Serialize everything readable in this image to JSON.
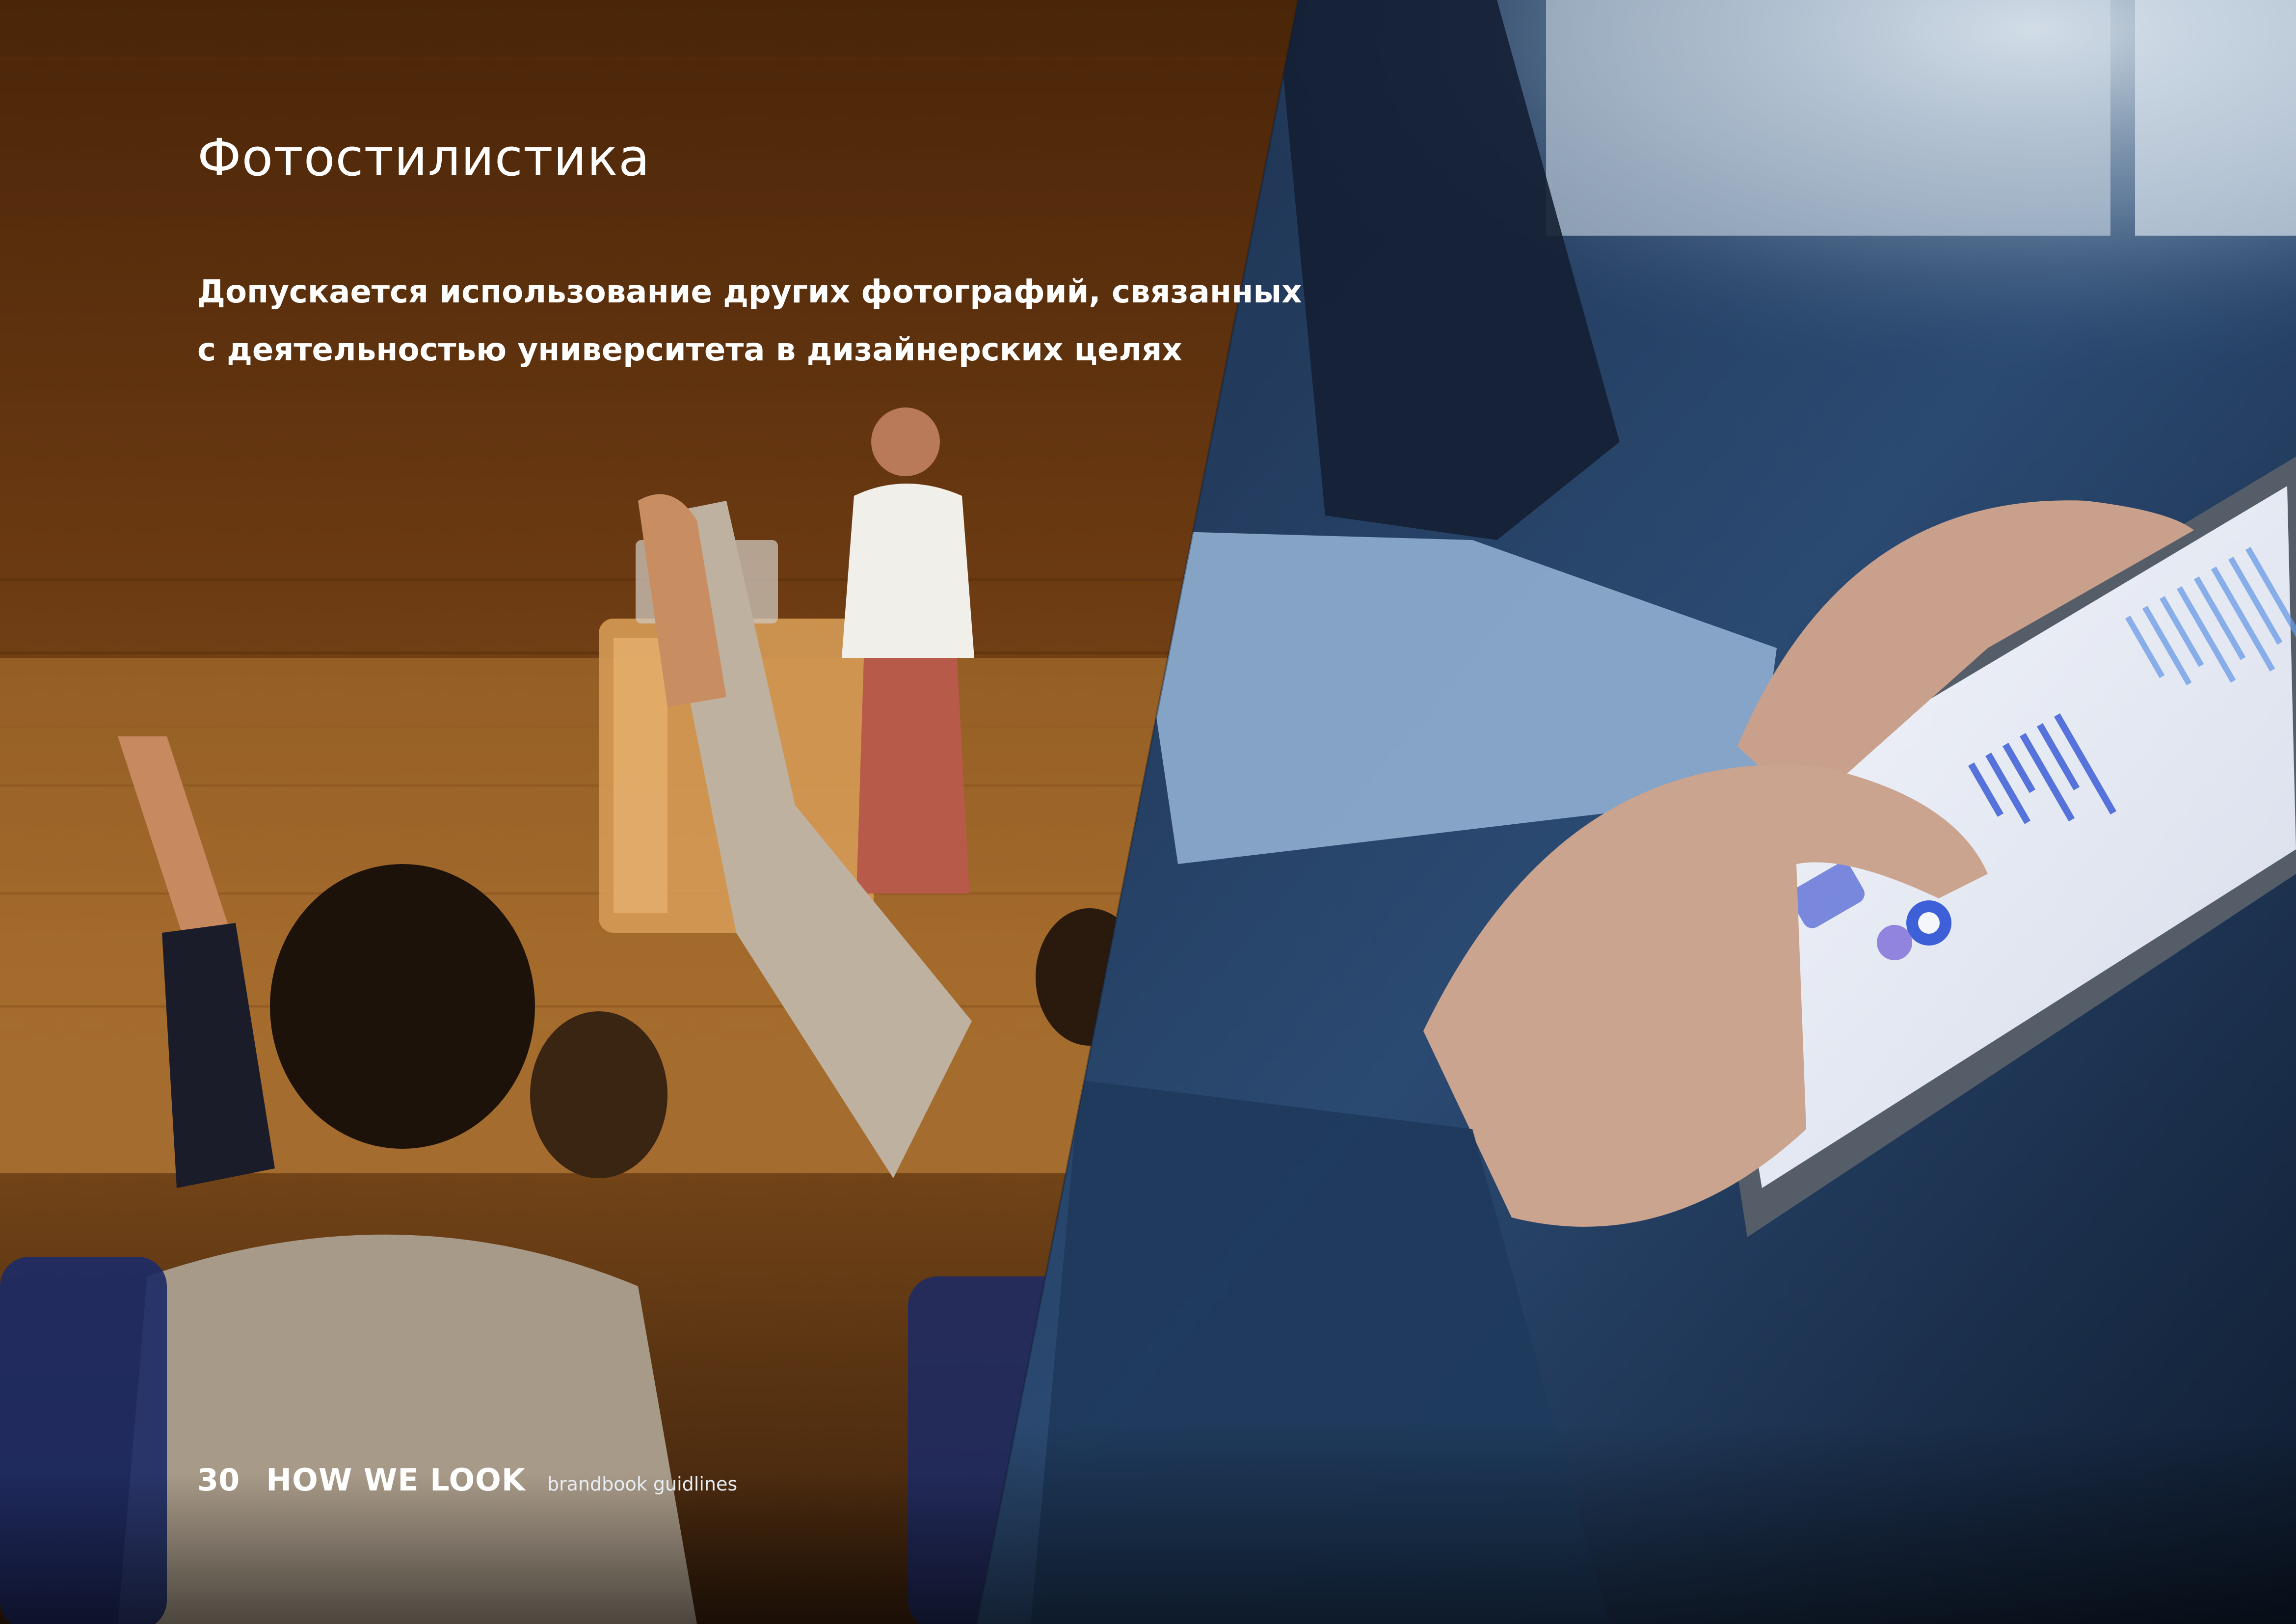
{
  "page": {
    "title": "Фотостилистика",
    "subtitle_lines": [
      "Допускается использование других фотографий, связанных",
      "с деятельностью университета в дизайнерских целях"
    ]
  },
  "footer": {
    "page_number": "30",
    "section_title": "HOW WE LOOK",
    "caption": "brandbook guidlines"
  },
  "photos": {
    "left": "conference-audience-raising-hands",
    "right": "hands-using-tablet-with-charts"
  },
  "colors": {
    "text": "#ffffff",
    "left_photo_warm": "#6a3c14",
    "right_photo_cool": "#1c3558",
    "chart_accent": "#3d5fd8"
  }
}
